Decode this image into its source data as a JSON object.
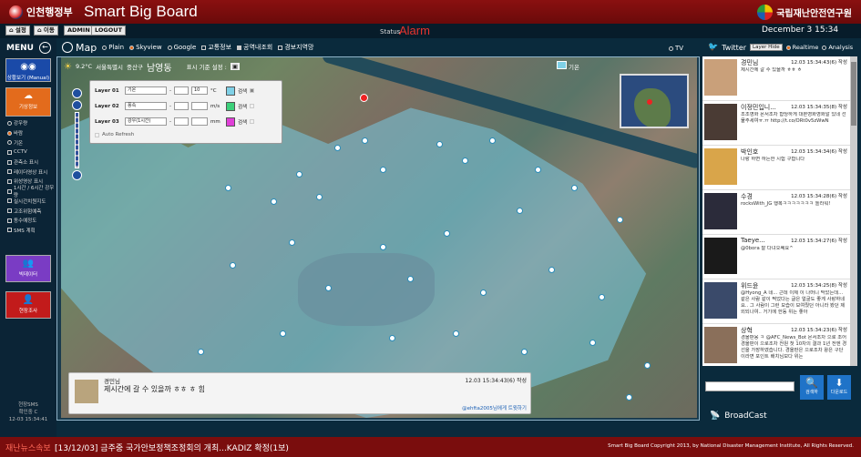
{
  "header": {
    "logo_text": "인천행정부",
    "app_title": "Smart Big Board",
    "institute": "국립재난안전연구원"
  },
  "nav": {
    "buttons": [
      "설정",
      "이동",
      "ADMIN",
      "LOGOUT"
    ]
  },
  "status": {
    "label": "Status",
    "value": "Alarm"
  },
  "datetime": "December 3  15:34",
  "menu": {
    "title": "MENU",
    "tiles": [
      {
        "label": "상황보기 (Manual)"
      },
      {
        "label": "기상정보"
      },
      {
        "label": "빅데이터"
      },
      {
        "label": "현장조사"
      }
    ],
    "options": [
      "강우량",
      "바람",
      "기온",
      "CCTV",
      "관측소 표시",
      "레이더영상 표시",
      "위성영상 표시",
      "1시간 / 6시간 강우량",
      "실시간치원지도",
      "고조위험예측",
      "동수예정도",
      "SMS 계획"
    ],
    "footer_line1": "현장SMS",
    "footer_line2": "확인중 C",
    "footer_time": "12-03 15:34:41"
  },
  "map": {
    "title": "Map",
    "view_options": [
      "Plain",
      "Skyview",
      "Google"
    ],
    "selected_view": "Skyview",
    "layer_toggles": [
      "교통정보",
      "공역내조회",
      "경보지역망"
    ],
    "tv_label": "TV",
    "location": {
      "temp": "9.2°C",
      "city": "서울특별시",
      "district": "중산구",
      "dong": "남영동",
      "setting_label": "표시 기준 설정 :"
    },
    "legend_label": "기온",
    "layers": [
      {
        "label": "Layer 01",
        "var": "기온",
        "value": "10",
        "unit": "°C",
        "color": "#7fd0e6",
        "color_label": "검색"
      },
      {
        "label": "Layer 02",
        "var": "풍속",
        "value": "",
        "unit": "m/s",
        "color": "#3cd07a",
        "color_label": "검색"
      },
      {
        "label": "Layer 03",
        "var": "강우(1시간)",
        "value": "",
        "unit": "mm",
        "color": "#e040d8",
        "color_label": "검색"
      }
    ],
    "auto_refresh_label": "Auto Refresh"
  },
  "tweet_popup": {
    "name": "경민님",
    "text": "제시간에 갈 수 있을까 ㅎㅎ ㅎ 힘",
    "time": "12.03 15:34:43(6) 작성",
    "footer": "@ehfta2005님에게 트윗하기"
  },
  "twitter": {
    "title": "Twitter",
    "layer_hide": "Layer Hide",
    "modes": [
      "Realtime",
      "Analysis"
    ],
    "selected_mode": "Realtime",
    "feed": [
      {
        "name": "경민님",
        "time": "12.03 15:34:43(6) 작성",
        "text": "제시간에 갈 수 있을까 ㅎㅎ ㅎ"
      },
      {
        "name": "이정민입니...",
        "time": "12.03 15:34:35(8) 작성",
        "text": "조조영화 몬서조차 합당하게 대본영화영화알 있네 선물주세여ㅠ.ㅠ http://t.co/ORt0v5zWwN"
      },
      {
        "name": "박인호",
        "time": "12.03 15:34:34(6) 작성",
        "text": "나랑 하면 하는한 시험 구합니다"
      },
      {
        "name": "수경",
        "time": "12.03 15:34:28(6) 작성",
        "text": "rocksWith_JG 행복ㅋㅋㅋㅋㅋㅋㅋ 놀라워!"
      },
      {
        "name": "Taeye...",
        "time": "12.03 15:34:27(6) 작성",
        "text": "@0bora 잘 다녀오쎄요^"
      },
      {
        "name": "위드윤",
        "time": "12.03 15:34:25(8) 작성",
        "text": "@Hyong_A 네... 근데 이제 이 나머니 막았는데... 같은 사람 같이 찍었다는 글은 얼굴도 좋게 사랑하네요.. 그 사람이 그런 모습이 보여줬던 아니라 봤던 제외되나여.. 거기에 한동 위는 좋아"
      },
      {
        "name": "상혁",
        "time": "12.03 15:34:23(6) 작성",
        "text": "경올판옹 ㅋ @AFC_News_Bot 몬서조차 으로 조어 경올판이 으로조차 전원 첫 10차의 결과 1년 전엔 경선을 가장하였습니다. 경올판은 으로조차 왕은 구단이라면 포인트 배치님보다 위는"
      }
    ]
  },
  "bottom_right": {
    "search_placeholder": "",
    "search_btn": "검색하",
    "download_btn": "다운로드",
    "broadcast": "BroadCast"
  },
  "ticker": {
    "label": "재난뉴스속보",
    "text": "[13/12/03] 금주중 국가안보정책조정회의 개최...KADIZ 확정(1보)",
    "copyright": "Smart Big Board Copyright 2013, by National Disaster Management Institute, All Rights Reserved."
  },
  "colors": {
    "header_red": "#8a1010",
    "alarm": "#e8332e",
    "overlay_blue": "#7fd0e6",
    "tile_blue": "#1a4aa8",
    "tile_orange": "#e36b1c",
    "tile_purple": "#7a3cc4",
    "tile_red": "#c21b1b"
  }
}
